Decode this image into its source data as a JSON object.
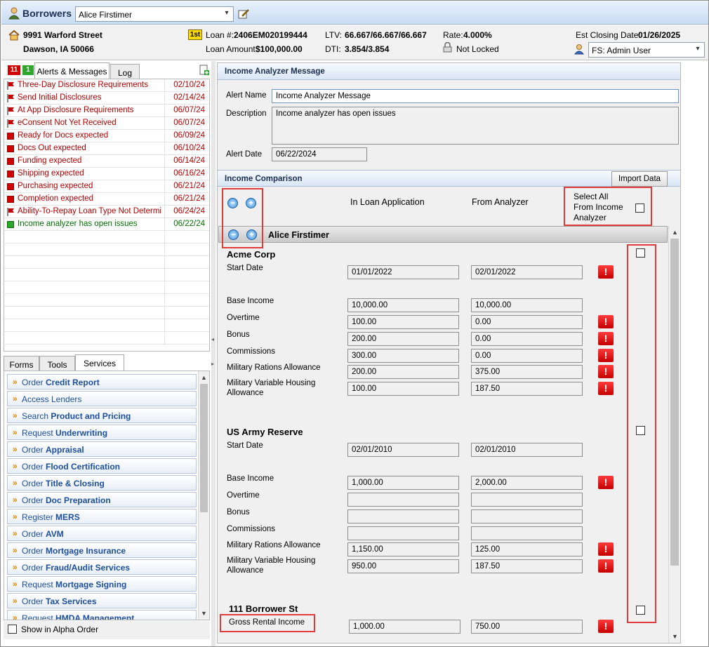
{
  "header": {
    "title": "Borrowers",
    "borrower_select": "Alice  Firstimer"
  },
  "info": {
    "address_line1": "9991 Warford Street",
    "address_line2": "Dawson, IA 50066",
    "lien_badge": "1st",
    "loan_num_label": "Loan #:",
    "loan_num": "2406EM020199444",
    "loan_amount_label": "Loan Amount:",
    "loan_amount": "$100,000.00",
    "ltv_label": "LTV:",
    "ltv": "66.667/66.667/66.667",
    "dti_label": "DTI:",
    "dti": "3.854/3.854",
    "rate_label": "Rate:",
    "rate": "4.000%",
    "lock_status": "Not Locked",
    "est_closing_label": "Est Closing Date:",
    "est_closing": "01/26/2025",
    "user_select": "FS: Admin User"
  },
  "alerts_tabs": {
    "count_red": "11",
    "count_green": "1",
    "alerts": "Alerts & Messages",
    "log": "Log"
  },
  "alerts": [
    {
      "text": "Three-Day Disclosure Requirements",
      "date": "02/10/24",
      "icon": "red-flag-icon",
      "color": "red"
    },
    {
      "text": "Send Initial Disclosures",
      "date": "02/14/24",
      "icon": "red-flag-icon",
      "color": "red"
    },
    {
      "text": "At App Disclosure Requirements",
      "date": "06/07/24",
      "icon": "red-flag-icon",
      "color": "red"
    },
    {
      "text": "eConsent Not Yet Received",
      "date": "06/07/24",
      "icon": "red-flag-icon",
      "color": "red"
    },
    {
      "text": "Ready for Docs expected",
      "date": "06/09/24",
      "icon": "red-square-icon",
      "color": "red"
    },
    {
      "text": "Docs Out expected",
      "date": "06/10/24",
      "icon": "red-square-icon",
      "color": "red"
    },
    {
      "text": "Funding expected",
      "date": "06/14/24",
      "icon": "red-square-icon",
      "color": "red"
    },
    {
      "text": "Shipping expected",
      "date": "06/16/24",
      "icon": "red-square-icon",
      "color": "red"
    },
    {
      "text": "Purchasing expected",
      "date": "06/21/24",
      "icon": "red-square-icon",
      "color": "red"
    },
    {
      "text": "Completion expected",
      "date": "06/21/24",
      "icon": "red-square-icon",
      "color": "red"
    },
    {
      "text": "Ability-To-Repay Loan Type Not Determine",
      "date": "06/24/24",
      "icon": "red-flag-icon",
      "color": "red"
    },
    {
      "text": "Income analyzer has open issues",
      "date": "06/22/24",
      "icon": "green-square-icon",
      "color": "green"
    }
  ],
  "svc_tabs": {
    "forms": "Forms",
    "tools": "Tools",
    "services": "Services"
  },
  "services": [
    {
      "pre": "Order ",
      "bold": "Credit Report"
    },
    {
      "pre": "",
      "bold": "",
      "plain": "Access Lenders"
    },
    {
      "pre": "Search ",
      "bold": "Product and Pricing"
    },
    {
      "pre": "Request ",
      "bold": "Underwriting"
    },
    {
      "pre": "Order ",
      "bold": "Appraisal"
    },
    {
      "pre": "Order ",
      "bold": "Flood Certification"
    },
    {
      "pre": "Order ",
      "bold": "Title & Closing"
    },
    {
      "pre": "Order ",
      "bold": "Doc Preparation"
    },
    {
      "pre": "Register ",
      "bold": "MERS"
    },
    {
      "pre": "Order ",
      "bold": "AVM"
    },
    {
      "pre": "Order ",
      "bold": "Mortgage Insurance"
    },
    {
      "pre": "Order ",
      "bold": "Fraud/Audit Services"
    },
    {
      "pre": "Request ",
      "bold": "Mortgage Signing"
    },
    {
      "pre": "Order ",
      "bold": "Tax Services"
    },
    {
      "pre": "Request ",
      "bold": "HMDA Management"
    }
  ],
  "show_alpha": "Show in Alpha Order",
  "message": {
    "section_title": "Income Analyzer Message",
    "alert_name_label": "Alert Name",
    "alert_name": "Income Analyzer Message",
    "description_label": "Description",
    "description": "Income analyzer has open issues",
    "alert_date_label": "Alert Date",
    "alert_date": "06/22/2024"
  },
  "comparison": {
    "section_title": "Income Comparison",
    "import_button": "Import Data",
    "col_loan_app": "In Loan Application",
    "col_analyzer": "From Analyzer",
    "select_all": [
      "Select All",
      "From Income",
      "Analyzer"
    ],
    "borrower_name": "Alice  Firstimer",
    "employer1": "Acme Corp",
    "employer2": "US Army Reserve",
    "property": "111 Borrower St",
    "labels": {
      "start_date": "Start Date",
      "base_income": "Base Income",
      "overtime": "Overtime",
      "bonus": "Bonus",
      "commissions": "Commissions",
      "mil_rations": "Military Rations Allowance",
      "mil_housing1": "Military Variable Housing",
      "mil_housing2": "Allowance",
      "gross_rental": "Gross Rental Income"
    },
    "acme": {
      "start_date": [
        "01/01/2022",
        "02/01/2022"
      ],
      "base_income": [
        "10,000.00",
        "10,000.00"
      ],
      "overtime": [
        "100.00",
        "0.00"
      ],
      "bonus": [
        "200.00",
        "0.00"
      ],
      "commissions": [
        "300.00",
        "0.00"
      ],
      "mil_rations": [
        "200.00",
        "375.00"
      ],
      "mil_housing": [
        "100.00",
        "187.50"
      ]
    },
    "army": {
      "start_date": [
        "02/01/2010",
        "02/01/2010"
      ],
      "base_income": [
        "1,000.00",
        "2,000.00"
      ],
      "overtime": [
        "",
        ""
      ],
      "bonus": [
        "",
        ""
      ],
      "commissions": [
        "",
        ""
      ],
      "mil_rations": [
        "1,150.00",
        "125.00"
      ],
      "mil_housing": [
        "950.00",
        "187.50"
      ]
    },
    "rental": [
      "1,000.00",
      "750.00"
    ]
  }
}
